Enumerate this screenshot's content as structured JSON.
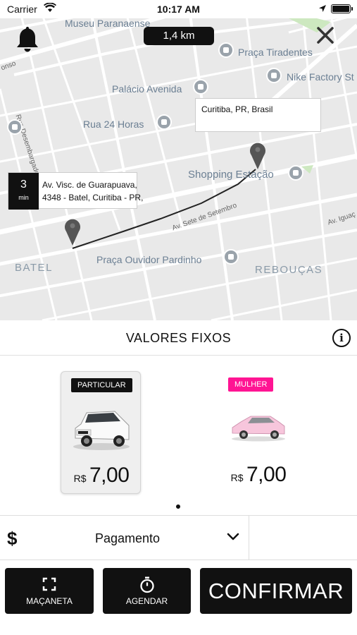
{
  "status_bar": {
    "carrier": "Carrier",
    "time": "10:17 AM"
  },
  "map": {
    "distance": "1,4 km",
    "destination": {
      "label": "Curitiba, PR, Brasil"
    },
    "origin": {
      "eta_value": "3",
      "eta_unit": "min",
      "address_line1": "Av. Visc. de Guarapuava,",
      "address_line2": "4348 - Batel, Curitiba - PR,"
    },
    "places": [
      "Museu Paranaense",
      "Praça Tiradentes",
      "Nike Factory St",
      "Palácio Avenida",
      "Rua 24 Horas",
      "Shopping Estação",
      "Praça Ouvidor Pardinho"
    ],
    "streets": [
      "Rua Desembargador Motta",
      "Av. Sete de Setembro",
      "Av. Iguaç",
      "onso"
    ],
    "districts": [
      "BATEL",
      "REBOUÇAS"
    ]
  },
  "panel": {
    "title": "VALORES FIXOS",
    "vehicles": [
      {
        "badge": "PARTICULAR",
        "badge_color": "#111111",
        "currency": "R$",
        "price": "7,00",
        "selected": true
      },
      {
        "badge": "MULHER",
        "badge_color": "#ff1493",
        "currency": "R$",
        "price": "7,00",
        "selected": false
      }
    ]
  },
  "payment": {
    "symbol": "$",
    "label": "Pagamento"
  },
  "actions": {
    "maçaneta": "MAÇANETA",
    "agendar": "AGENDAR",
    "confirmar": "CONFIRMAR"
  }
}
